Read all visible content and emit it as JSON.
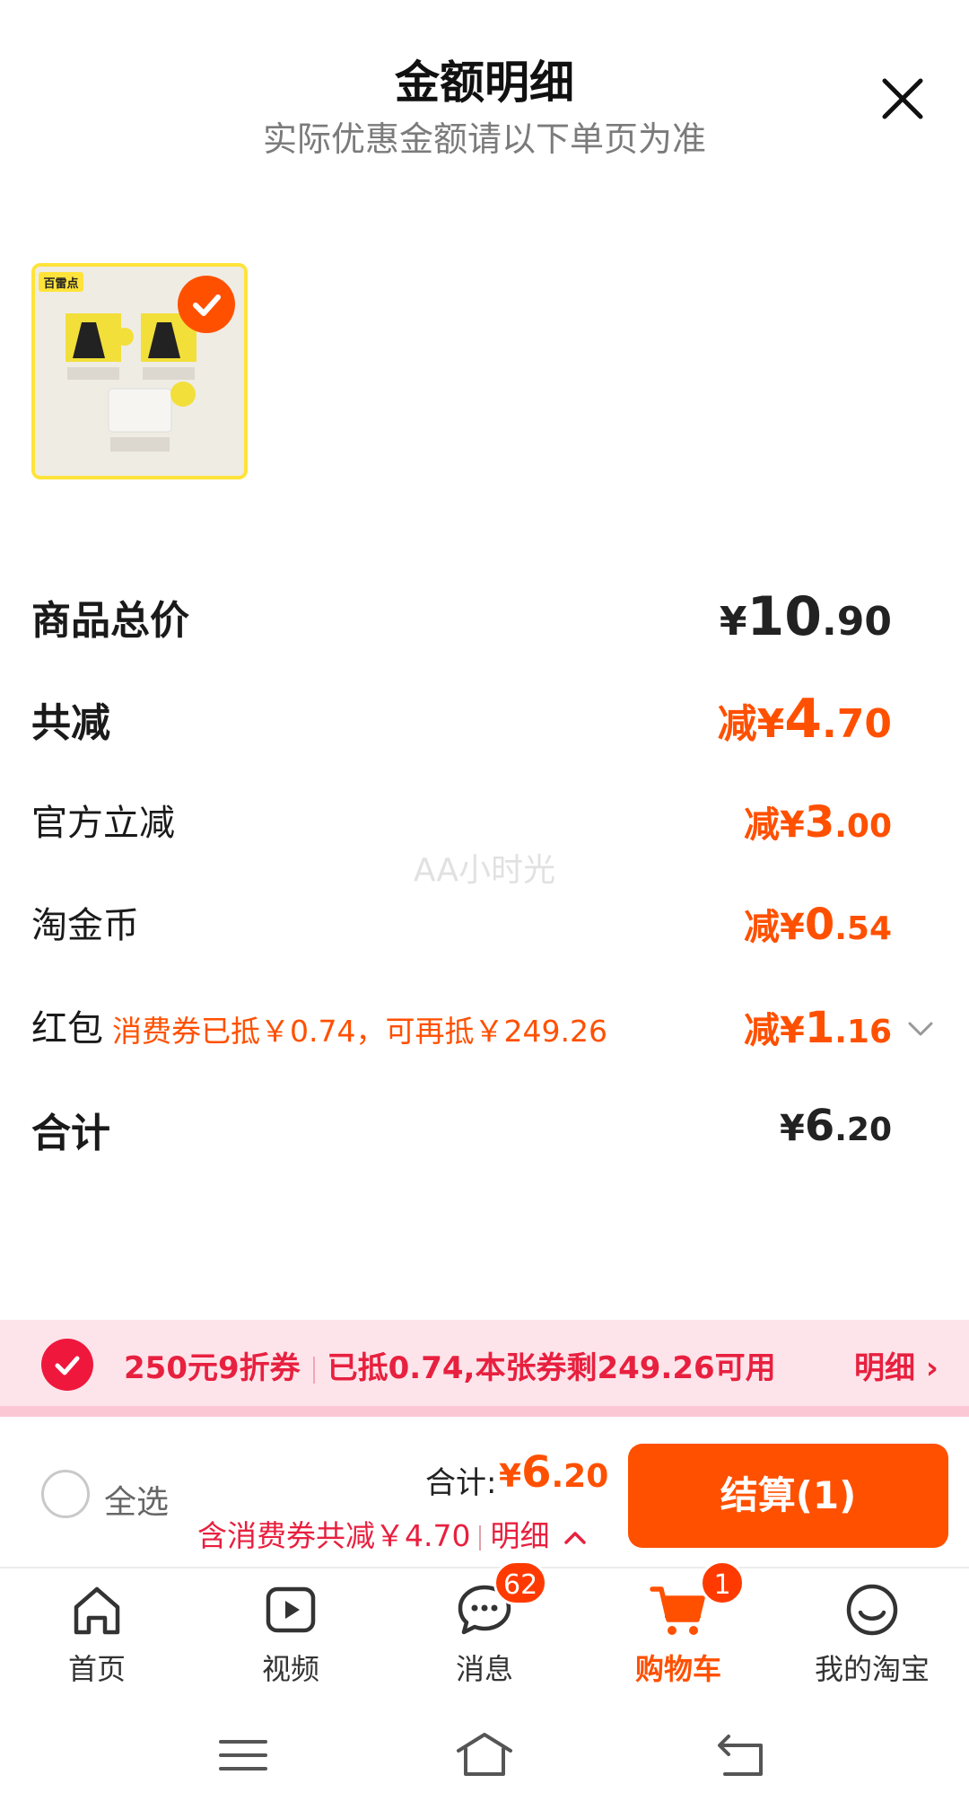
{
  "header": {
    "title": "金额明细",
    "subtitle": "实际优惠金额请以下单页为准"
  },
  "product": {
    "brand_tag": "百雷点",
    "selected": true
  },
  "details": {
    "total_price": {
      "label": "商品总价",
      "currency": "¥",
      "int": "10",
      "dec": ".90"
    },
    "total_reduction": {
      "label": "共减",
      "prefix": "减",
      "currency": "¥",
      "int": "4",
      "dec": ".70"
    },
    "official_discount": {
      "label": "官方立减",
      "prefix": "减",
      "currency": "¥",
      "int": "3",
      "dec": ".00"
    },
    "taojin_coin": {
      "label": "淘金币",
      "prefix": "减",
      "currency": "¥",
      "int": "0",
      "dec": ".54"
    },
    "red_packet": {
      "label": "红包",
      "note": "消费券已抵￥0.74，可再抵￥249.26",
      "prefix": "减",
      "currency": "¥",
      "int": "1",
      "dec": ".16"
    },
    "sum": {
      "label": "合计",
      "currency": "¥",
      "int": "6",
      "dec": ".20"
    }
  },
  "watermark": "AA小时光",
  "coupon_banner": {
    "coupon_name": "250元9折券",
    "coupon_status": "已抵0.74,本张券剩249.26可用",
    "detail_label": "明细 ›"
  },
  "checkout": {
    "select_all_label": "全选",
    "total_label": "合计:",
    "total_currency": "¥",
    "total_int": "6",
    "total_dec": ".20",
    "discount_note": "含消费券共减￥4.70",
    "discount_detail_label": "明细",
    "checkout_button": "结算(1)"
  },
  "tabbar": {
    "items": [
      {
        "label": "首页",
        "icon": "home-icon"
      },
      {
        "label": "视频",
        "icon": "video-icon"
      },
      {
        "label": "消息",
        "icon": "message-icon",
        "badge": "62"
      },
      {
        "label": "购物车",
        "icon": "cart-icon",
        "badge": "1",
        "active": true
      },
      {
        "label": "我的淘宝",
        "icon": "profile-icon"
      }
    ]
  },
  "colors": {
    "accent": "#ff5000",
    "coupon_red": "#e8203f",
    "coupon_bg": "#fde4ea"
  }
}
